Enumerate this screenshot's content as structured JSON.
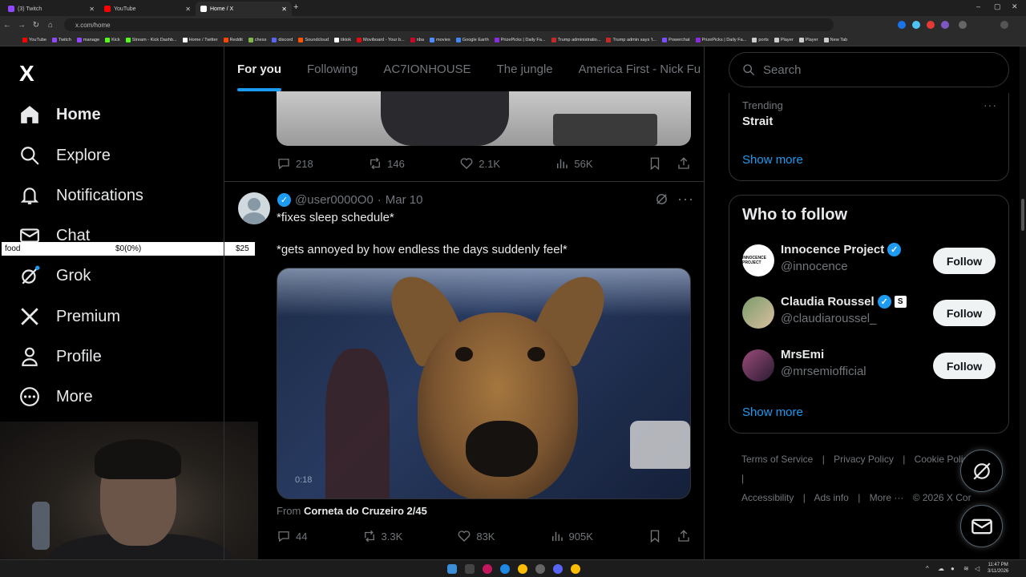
{
  "browser": {
    "tabs": [
      {
        "label": "(3) Twitch",
        "color": "#9146ff"
      },
      {
        "label": "YouTube",
        "color": "#ff0000"
      },
      {
        "label": "Home / X",
        "color": "#ffffff"
      }
    ],
    "new_tab": "+",
    "url": "x.com/home",
    "window_controls": [
      "–",
      "▢",
      "✕"
    ],
    "bookmarks": [
      {
        "label": "YouTube",
        "color": "#ff0000"
      },
      {
        "label": "Twitch",
        "color": "#9146ff"
      },
      {
        "label": "manage",
        "color": "#9146ff"
      },
      {
        "label": "Kick",
        "color": "#53fc18"
      },
      {
        "label": "Stream - Kick Dashb...",
        "color": "#53fc18"
      },
      {
        "label": "Home / Twitter",
        "color": "#ffffff"
      },
      {
        "label": "Reddit",
        "color": "#ff4500"
      },
      {
        "label": "chess",
        "color": "#81b64c"
      },
      {
        "label": "discord",
        "color": "#5865f2"
      },
      {
        "label": "Soundcloud",
        "color": "#ff5500"
      },
      {
        "label": "tiktok",
        "color": "#ffffff"
      },
      {
        "label": "Moviboard - Your b...",
        "color": "#e50914"
      },
      {
        "label": "nba",
        "color": "#c9082a"
      },
      {
        "label": "movies",
        "color": "#4f8cff"
      },
      {
        "label": "Google Earth",
        "color": "#4285f4"
      },
      {
        "label": "PrizePicks | Daily Fa...",
        "color": "#8a2be2"
      },
      {
        "label": "Trump administratio...",
        "color": "#c62828"
      },
      {
        "label": "Trump admin says 't...",
        "color": "#c62828"
      },
      {
        "label": "Powerchat",
        "color": "#7c4dff"
      },
      {
        "label": "PrizePicks | Daily Fa...",
        "color": "#8a2be2"
      },
      {
        "label": "ports",
        "color": "#cccccc"
      },
      {
        "label": "Player",
        "color": "#cccccc"
      },
      {
        "label": "Player",
        "color": "#cccccc"
      },
      {
        "label": "New Tab",
        "color": "#cccccc"
      }
    ]
  },
  "nav": {
    "logo": "X",
    "items": [
      {
        "label": "Home",
        "icon": "home-icon"
      },
      {
        "label": "Explore",
        "icon": "search-icon"
      },
      {
        "label": "Notifications",
        "icon": "bell-icon"
      },
      {
        "label": "Chat",
        "icon": "mail-icon"
      },
      {
        "label": "Grok",
        "icon": "grok-icon"
      },
      {
        "label": "Premium",
        "icon": "x-icon"
      },
      {
        "label": "Profile",
        "icon": "person-icon"
      },
      {
        "label": "More",
        "icon": "more-circle-icon"
      }
    ]
  },
  "overlay_ticker": {
    "label": "food",
    "progress": "$0(0%)",
    "goal": "$25"
  },
  "timeline": {
    "tabs": [
      "For you",
      "Following",
      "AC7IONHOUSE",
      "The jungle",
      "America First - Nick Fu"
    ],
    "prev_post_stats": {
      "replies": "218",
      "reposts": "146",
      "likes": "2.1K",
      "views": "56K"
    },
    "post": {
      "handle": "@user0000O0",
      "separator": "·",
      "date": "Mar 10",
      "line1": "*fixes sleep schedule*",
      "line2": "*gets annoyed by how endless the days suddenly feel*",
      "video_time": "0:18",
      "from_label": "From",
      "from_source": "Corneta do Cruzeiro 2/45",
      "stats": {
        "replies": "44",
        "reposts": "3.3K",
        "likes": "83K",
        "views": "905K"
      }
    }
  },
  "sidebar": {
    "search_placeholder": "Search",
    "trending": {
      "label": "Trending",
      "name": "Strait",
      "more": "···"
    },
    "show_more": "Show more",
    "who_to_follow": {
      "title": "Who to follow",
      "users": [
        {
          "name": "Innocence Project",
          "handle": "@innocence",
          "avatar_text": "INNOCENCE PROJECT",
          "verified": true,
          "badge": ""
        },
        {
          "name": "Claudia Roussel",
          "handle": "@claudiaroussel_",
          "avatar_text": "",
          "verified": true,
          "badge": "S"
        },
        {
          "name": "MrsEmi",
          "handle": "@mrsemiofficial",
          "avatar_text": "",
          "verified": false,
          "badge": ""
        }
      ],
      "follow_label": "Follow",
      "show_more": "Show more"
    },
    "footer": {
      "links_row1": [
        "Terms of Service",
        "|",
        "Privacy Policy",
        "|",
        "Cookie Policy",
        "|"
      ],
      "links_row2": [
        "Accessibility",
        "|",
        "Ads info",
        "|",
        "More ···",
        "© 2026 X Cor"
      ]
    }
  },
  "taskbar": {
    "time": "11:47 PM",
    "date": "3/11/2026"
  },
  "colors": {
    "accent": "#1d9bf0",
    "text": "#e7e9ea",
    "muted": "#71767b",
    "border": "#2f3336"
  }
}
